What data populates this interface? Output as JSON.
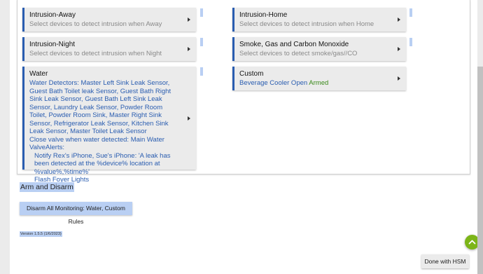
{
  "cards": {
    "intrusion_away": {
      "title": "Intrusion-Away",
      "subtitle": "Select devices to detect intrusion when Away"
    },
    "intrusion_home": {
      "title": "Intrusion-Home",
      "subtitle": "Select devices to detect intrusion when Home"
    },
    "intrusion_night": {
      "title": "Intrusion-Night",
      "subtitle": "Select devices to detect intrusion when Night"
    },
    "smoke_gas": {
      "title": "Smoke, Gas and Carbon Monoxide",
      "subtitle": "Select devices to detect smoke/gas//CO"
    },
    "water": {
      "title": "Water",
      "detectors": "Water Detectors: Master Left Sink Leak Sensor, Guest Bath Toilet leak Sensor, Guest Bath Right Sink Leak Sensor, Guest Bath Left Sink Leak Sensor, Laundry Leak Sensor, Powder Room Toilet, Powder Room Sink, Master Right Sink Sensor, Refrigerator Leak Sensor, Kitchen Sink Leak Sensor, Master Toilet Leak Sensor",
      "valve": "Close valve when water detected: Main Water ValveAlerts:",
      "notify": "Notify Rex's iPhone, Sue's iPhone: 'A leak has been detected at the %device% location at %value%,%time%'",
      "flash": "Flash Foyer Lights"
    },
    "custom": {
      "title": "Custom",
      "detail": "Beverage Cooler Open",
      "status": "Armed"
    }
  },
  "arm_disarm": {
    "title": "Arm and Disarm",
    "disarm_button": "Disarm All Monitoring: Water, Custom Rules"
  },
  "version": "Version 1.5.5 (1/6/2023)",
  "done_button": "Done with HSM",
  "colors": {
    "accent": "#2a5db0",
    "armed": "#3a8a1a",
    "fab": "#7cb518",
    "selection": "#b9cff3"
  }
}
